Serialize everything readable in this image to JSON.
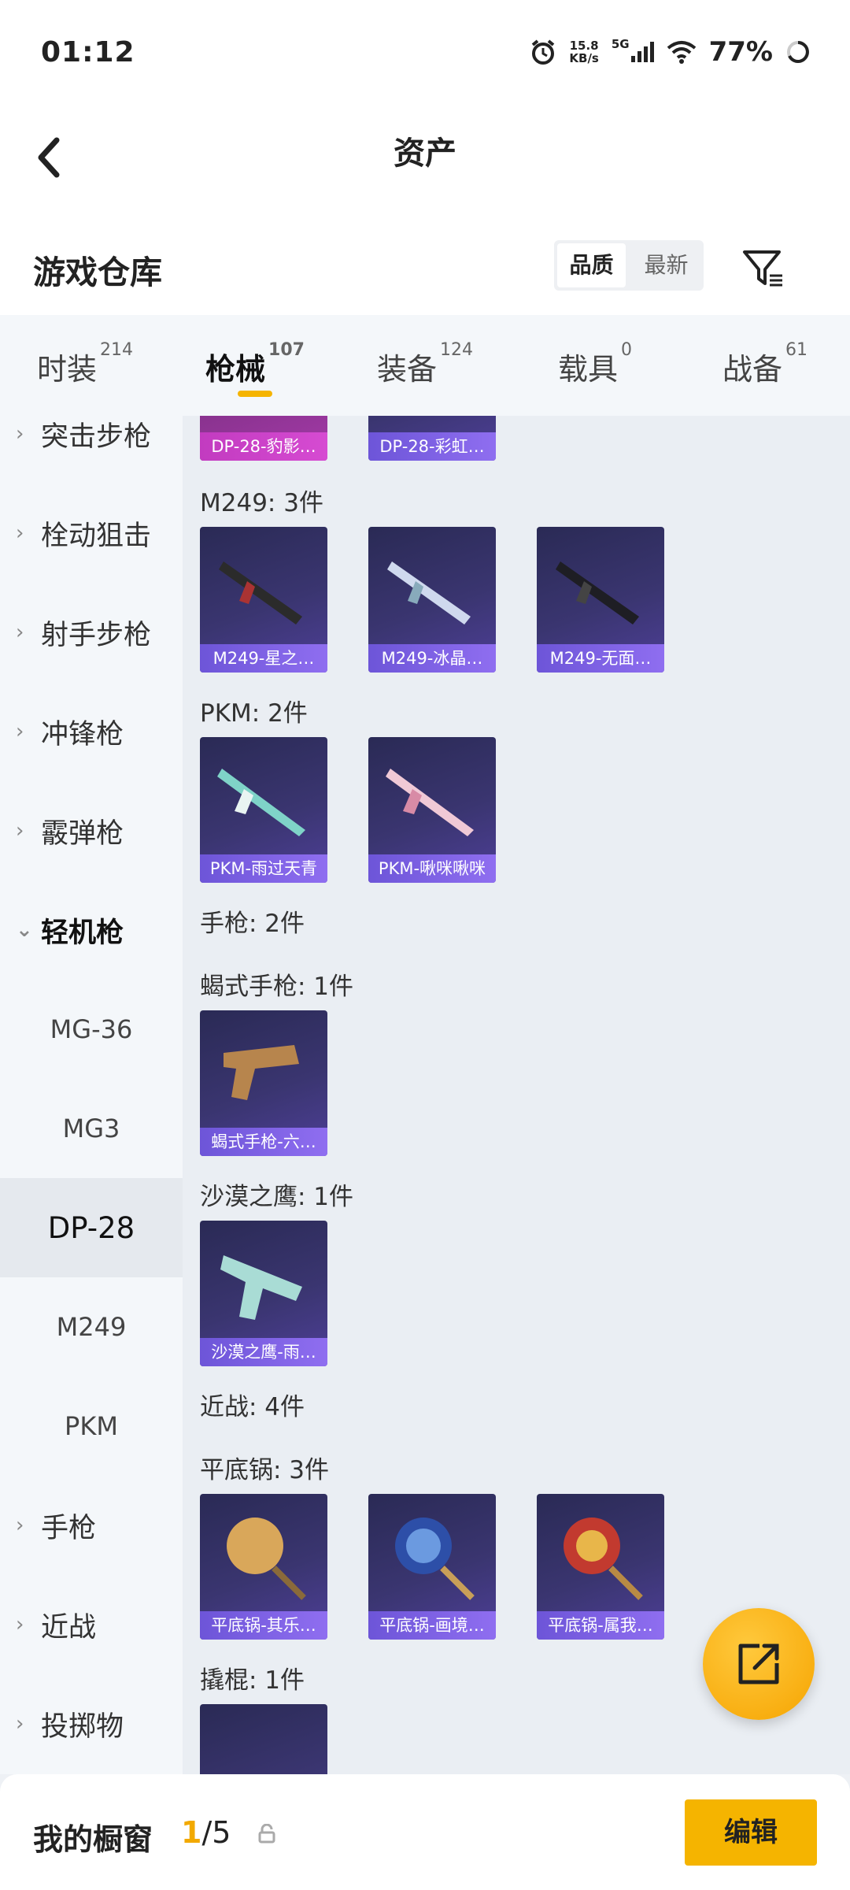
{
  "status_bar": {
    "time": "01:12",
    "speed": "15.8",
    "speed_unit": "KB/s",
    "network": "5G",
    "battery": "77%"
  },
  "nav": {
    "title": "资产"
  },
  "warehouse": {
    "title": "游戏仓库",
    "sort_options": [
      "品质",
      "最新"
    ],
    "active_sort": "品质"
  },
  "tabs": [
    {
      "label": "时装",
      "count": "214"
    },
    {
      "label": "枪械",
      "count": "107"
    },
    {
      "label": "装备",
      "count": "124"
    },
    {
      "label": "载具",
      "count": "0"
    },
    {
      "label": "战备",
      "count": "61"
    }
  ],
  "sidebar": {
    "items": [
      {
        "label": "突击步枪"
      },
      {
        "label": "栓动狙击"
      },
      {
        "label": "射手步枪"
      },
      {
        "label": "冲锋枪"
      },
      {
        "label": "霰弹枪"
      },
      {
        "label": "轻机枪"
      },
      {
        "label": "MG-36"
      },
      {
        "label": "MG3"
      },
      {
        "label": "DP-28"
      },
      {
        "label": "M249"
      },
      {
        "label": "PKM"
      },
      {
        "label": "手枪"
      },
      {
        "label": "近战"
      },
      {
        "label": "投掷物"
      }
    ]
  },
  "content": {
    "top_cards": [
      "DP-28-豹影…",
      "DP-28-彩虹…"
    ],
    "m249": {
      "header": "M249: 3件",
      "cards": [
        "M249-星之…",
        "M249-冰晶…",
        "M249-无面…"
      ]
    },
    "pkm": {
      "header": "PKM: 2件",
      "cards": [
        "PKM-雨过天青",
        "PKM-啾咪啾咪"
      ]
    },
    "pistol_header": "手枪: 2件",
    "scorpion": {
      "header": "蝎式手枪: 1件",
      "cards": [
        "蝎式手枪-六…"
      ]
    },
    "deagle": {
      "header": "沙漠之鹰: 1件",
      "cards": [
        "沙漠之鹰-雨…"
      ]
    },
    "melee_header": "近战: 4件",
    "pan": {
      "header": "平底锅: 3件",
      "cards": [
        "平底锅-其乐…",
        "平底锅-画境…",
        "平底锅-属我…"
      ]
    },
    "crowbar": {
      "header": "撬棍: 1件"
    }
  },
  "bottom": {
    "label": "我的橱窗",
    "current": "1",
    "total": "/5",
    "edit": "编辑"
  }
}
